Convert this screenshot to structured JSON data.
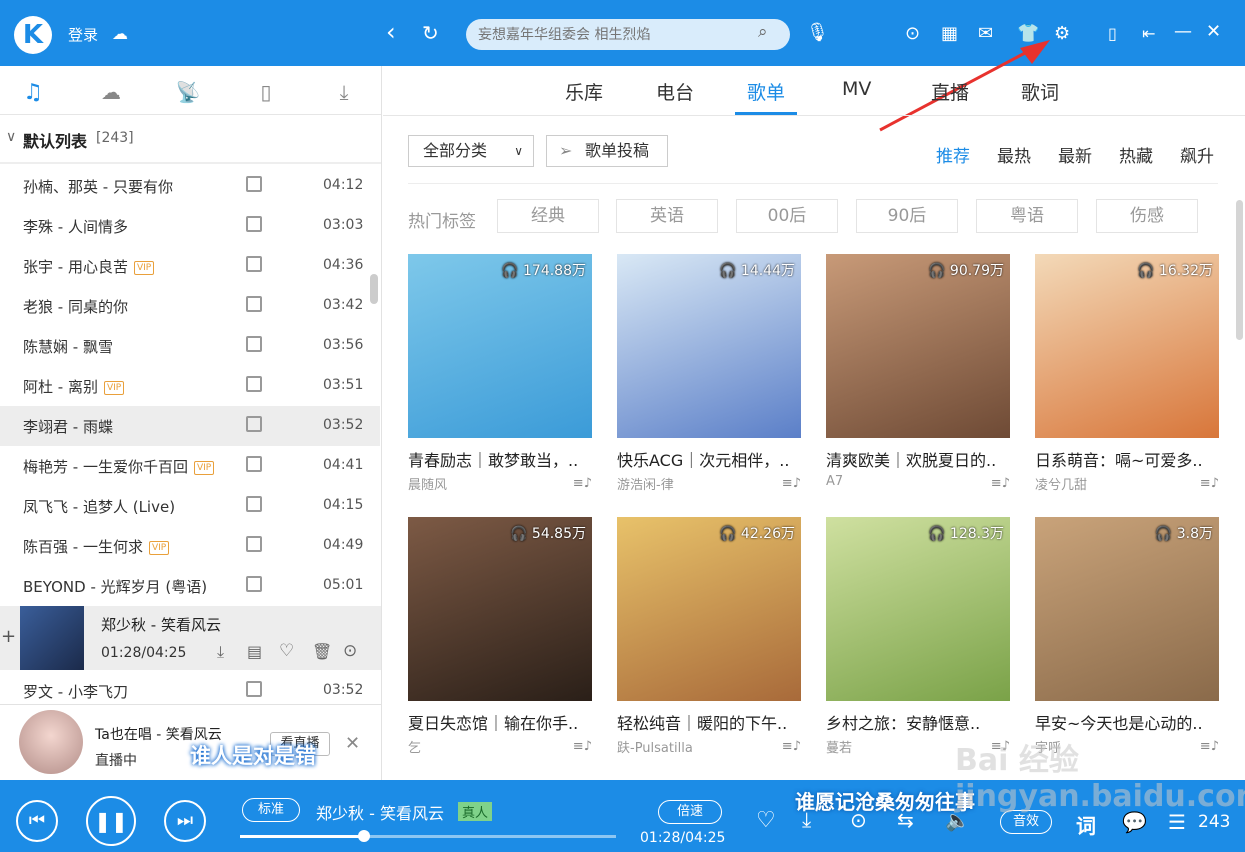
{
  "topbar": {
    "login": "登录",
    "search_placeholder": "妄想嘉年华组委会 相生烈焰"
  },
  "nav_tabs": [
    "乐库",
    "电台",
    "歌单",
    "MV",
    "直播",
    "歌词"
  ],
  "sidebar": {
    "list_title": "默认列表",
    "list_count": "[243]",
    "songs": [
      {
        "title": "孙楠、那英 - 只要有你",
        "dur": "04:12",
        "vip": ""
      },
      {
        "title": "李殊 - 人间情多",
        "dur": "03:03",
        "vip": ""
      },
      {
        "title": "张宇 - 用心良苦",
        "dur": "04:36",
        "vip": "VIP"
      },
      {
        "title": "老狼 - 同桌的你",
        "dur": "03:42",
        "vip": ""
      },
      {
        "title": "陈慧娴 - 飘雪",
        "dur": "03:56",
        "vip": ""
      },
      {
        "title": "阿杜 - 离别",
        "dur": "03:51",
        "vip": "VIP"
      },
      {
        "title": "李翊君 - 雨蝶",
        "dur": "03:52",
        "vip": ""
      },
      {
        "title": "梅艳芳 - 一生爱你千百回",
        "dur": "04:41",
        "vip": "VIP"
      },
      {
        "title": "凤飞飞 - 追梦人 (Live)",
        "dur": "04:15",
        "vip": ""
      },
      {
        "title": "陈百强 - 一生何求",
        "dur": "04:49",
        "vip": "VIP"
      },
      {
        "title": "BEYOND - 光辉岁月 (粤语)",
        "dur": "05:01",
        "vip": ""
      }
    ],
    "playing": {
      "title": "郑少秋 - 笑看风云",
      "time": "01:28/04:25"
    },
    "after": {
      "title": "罗文 - 小李飞刀",
      "dur": "03:52"
    },
    "live": {
      "text": "Ta也在唱 - 笑看风云",
      "status": "直播中",
      "button": "看直播",
      "overlay": "谁人是对是错"
    }
  },
  "filter": {
    "category": "全部分类",
    "submit": "歌单投稿",
    "sorts": [
      "推荐",
      "最热",
      "最新",
      "热藏",
      "飙升"
    ]
  },
  "tags": {
    "label": "热门标签",
    "items": [
      "经典",
      "英语",
      "00后",
      "90后",
      "粤语",
      "伤感"
    ]
  },
  "playlists": [
    {
      "count": "174.88万",
      "title": "青春励志｜敢梦敢当，..",
      "author": "晨随风",
      "c1": "#7ec8ea",
      "c2": "#3b9bd8"
    },
    {
      "count": "14.44万",
      "title": "快乐ACG｜次元相伴，..",
      "author": "游浩闲-律",
      "c1": "#d9e8f5",
      "c2": "#5b7fc8"
    },
    {
      "count": "90.79万",
      "title": "清爽欧美｜欢脱夏日的..",
      "author": "A7",
      "c1": "#c89a78",
      "c2": "#6e4a35"
    },
    {
      "count": "16.32万",
      "title": "日系萌音：嗝~可爱多..",
      "author": "凌兮几甜",
      "c1": "#f3d9b8",
      "c2": "#d8763a"
    },
    {
      "count": "54.85万",
      "title": "夏日失恋馆｜输在你手..",
      "author": "乞",
      "c1": "#7d5a45",
      "c2": "#2a1f18"
    },
    {
      "count": "42.26万",
      "title": "轻松纯音｜暖阳的下午..",
      "author": "趺-Pulsatilla",
      "c1": "#e8c26a",
      "c2": "#a86a3a"
    },
    {
      "count": "128.3万",
      "title": "乡村之旅：安静惬意..",
      "author": "蔓若",
      "c1": "#cfe0a0",
      "c2": "#7aa248"
    },
    {
      "count": "3.8万",
      "title": "早安~今天也是心动的..",
      "author": "宇呼",
      "c1": "#c9a37a",
      "c2": "#8a6a4a"
    }
  ],
  "player": {
    "quality": "标准",
    "song": "郑少秋 - 笑看风云",
    "tag": "真人",
    "speed": "倍速",
    "time": "01:28/04:25",
    "overlay": "谁愿记沧桑匆匆往事",
    "effect": "音效",
    "lyric": "词",
    "count": "243",
    "progress": 0.33
  },
  "watermark": "Bai 经验 jingyan.baidu.com"
}
